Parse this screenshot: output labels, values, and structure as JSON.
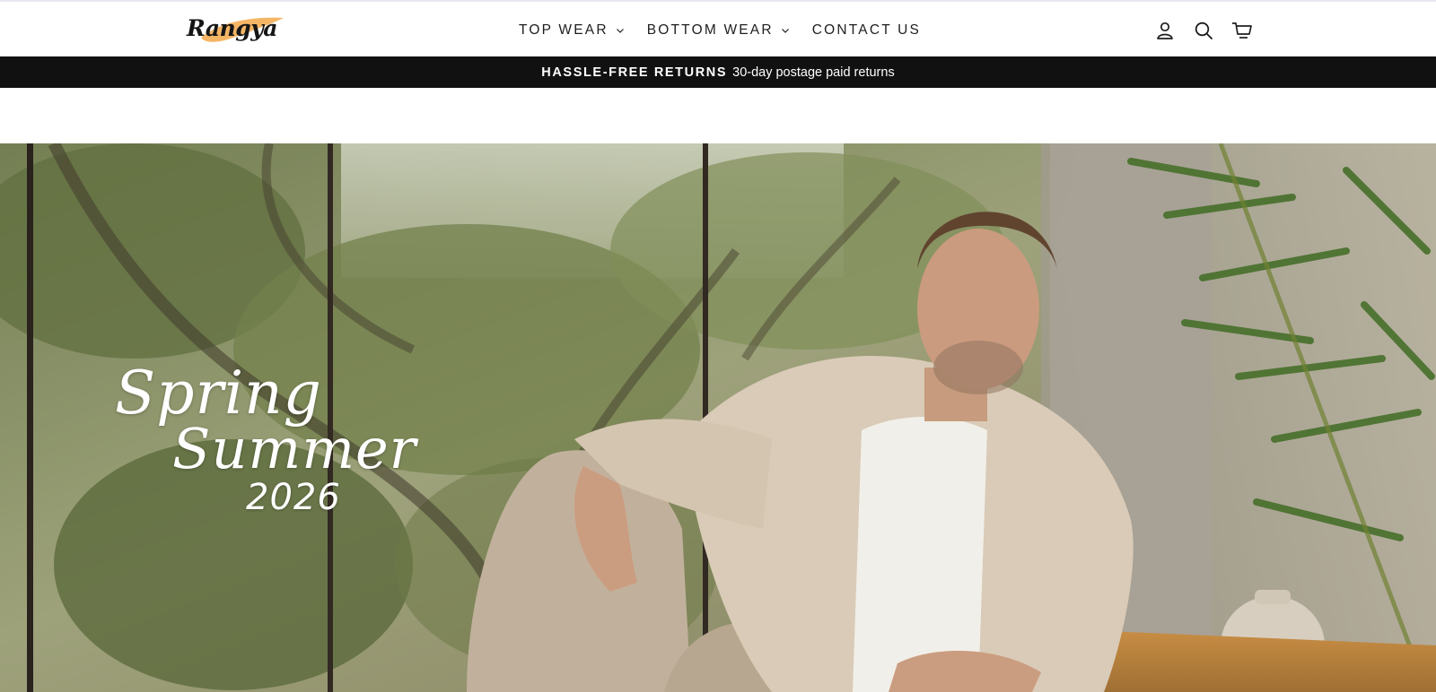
{
  "brand": {
    "logo_text": "Rangya",
    "accent": "#f2a94a"
  },
  "nav": {
    "items": [
      {
        "label": "TOP WEAR",
        "has_dropdown": true
      },
      {
        "label": "BOTTOM WEAR",
        "has_dropdown": true
      },
      {
        "label": "CONTACT US",
        "has_dropdown": false
      }
    ]
  },
  "header_icons": [
    "account-icon",
    "search-icon",
    "cart-icon"
  ],
  "announcement": {
    "strong": "HASSLE-FREE RETURNS",
    "text": "30-day postage paid returns",
    "background": "#111111"
  },
  "hero": {
    "script_line1": "Spring",
    "script_line2": "Summer",
    "script_line3": "2026"
  }
}
